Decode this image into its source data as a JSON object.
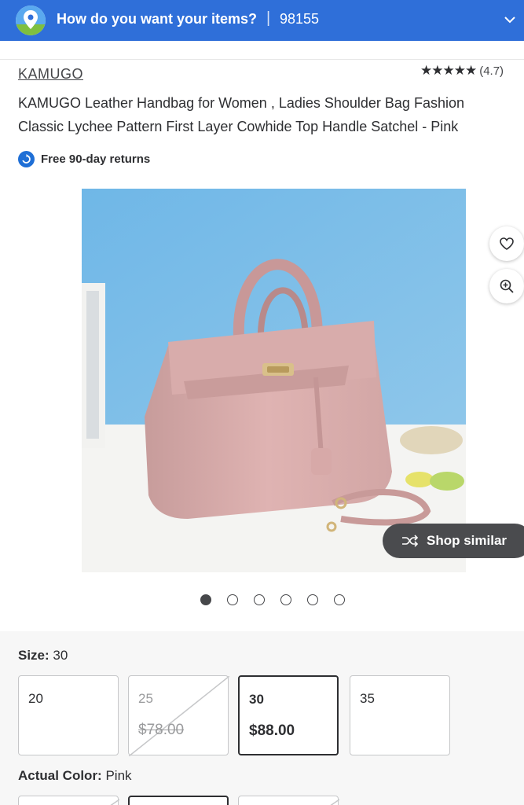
{
  "header": {
    "prompt": "How do you want your items?",
    "separator": "|",
    "zip": "98155",
    "location_icon": "location-pin-icon",
    "chevron_icon": "chevron-down-icon"
  },
  "product": {
    "brand": "KAMUGO",
    "rating_stars": "★★★★★",
    "rating_value": "(4.7)",
    "title": "KAMUGO Leather Handbag for Women , Ladies Shoulder Bag Fashion Classic Lychee Pattern First Layer Cowhide Top Handle Satchel - Pink",
    "returns_label": "Free 90-day returns"
  },
  "gallery": {
    "shop_similar_label": "Shop similar",
    "dots_count": 6,
    "active_index": 0
  },
  "size": {
    "label": "Size:",
    "selected": "30",
    "options": [
      {
        "size": "20",
        "price": ""
      },
      {
        "size": "25",
        "price": "$78.00"
      },
      {
        "size": "30",
        "price": "$88.00"
      },
      {
        "size": "35",
        "price": ""
      }
    ]
  },
  "color": {
    "label": "Actual Color:",
    "selected": "Pink"
  },
  "colors": {
    "brand_blue": "#2f6fd9",
    "text": "#2e2f32",
    "returns_blue": "#1f6fd6",
    "pill_bg": "#4a4b4e"
  }
}
